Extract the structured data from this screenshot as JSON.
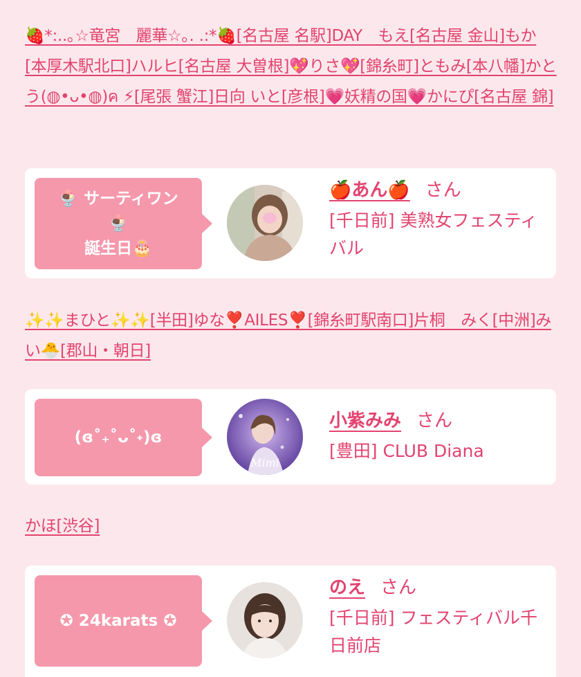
{
  "top_links": [
    "🍓*:..｡☆竜宮　麗華☆｡. .:*🍓",
    "[名古屋 名駅]",
    "DAY　もえ",
    "[名古屋 金山]",
    "もか",
    "[本厚木駅北口]",
    "ハルヒ",
    "[名古屋 大曽根]",
    "💖りさ💖",
    "[錦糸町]",
    "ともみ",
    "[本八幡]",
    "かとう(◍•ᴗ•◍)ค ⚡",
    "[尾張 蟹江]",
    "日向 いと",
    "[彦根]",
    "💗妖精の国💗かにぴ",
    "[名古屋 錦]"
  ],
  "cards": [
    {
      "bubble_line1": "🍨 サーティワン",
      "bubble_line2": "🍨",
      "bubble_line3": "誕生日🎂",
      "name": "🍎あん🍎",
      "san": "さん",
      "shop": "[千日前] 美熟女フェスティバル"
    },
    {
      "bubble_line1": "(ɞ˚₊˚ᴗ˚˖)ɞ",
      "name": "小紫みみ",
      "san": "さん",
      "shop": "[豊田] CLUB Diana"
    },
    {
      "bubble_line1": "✪ 24karats ✪",
      "name": "のえ",
      "san": "さん",
      "shop": "[千日前] フェスティバル千日前店"
    }
  ],
  "mid_links": [
    "✨✨まひと✨✨",
    "[半田]",
    "ゆな❣️AILES❣️",
    "[錦糸町駅南口]",
    "片桐　みく",
    "[中洲]",
    "みい🐣",
    "[郡山・朝日]"
  ],
  "lower_links": [
    "かほ",
    "[渋谷]"
  ],
  "colors": {
    "background": "#fce8ec",
    "accent": "#e2436f",
    "bubble": "#f598ac"
  }
}
